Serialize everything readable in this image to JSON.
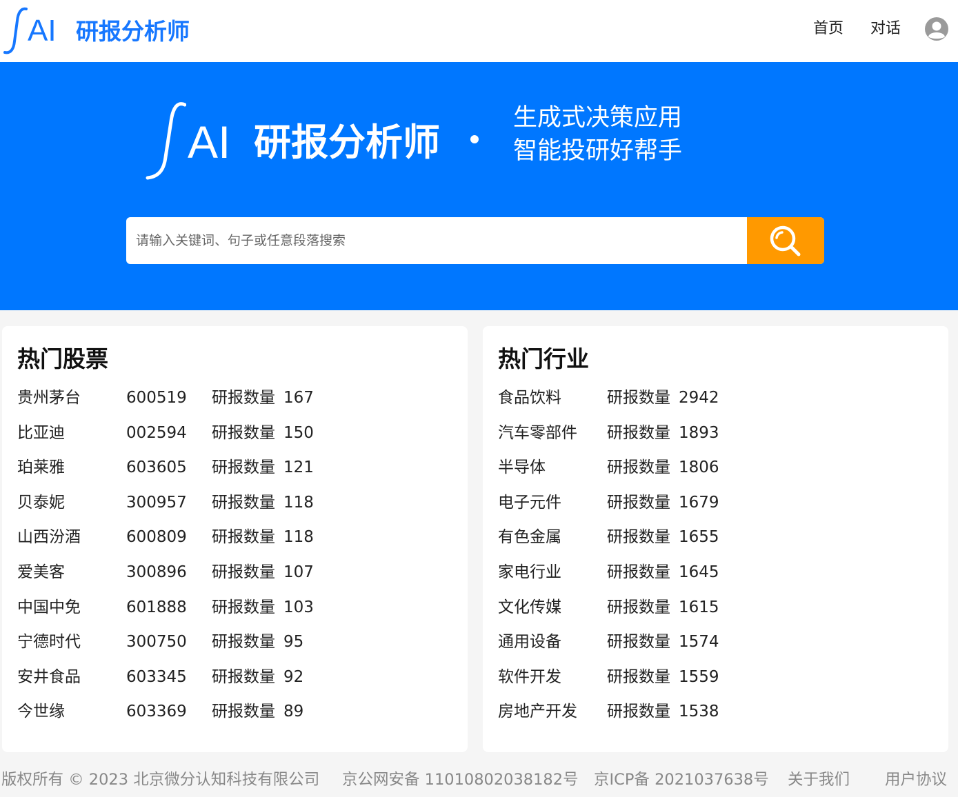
{
  "header": {
    "logo_ai": "AI",
    "app_name": "研报分析师",
    "nav": {
      "home": "首页",
      "chat": "对话"
    }
  },
  "hero": {
    "logo_ai": "AI",
    "app_name": "研报分析师",
    "tagline_line1": "生成式决策应用",
    "tagline_line2": "智能投研好帮手"
  },
  "search": {
    "placeholder": "请输入关键词、句子或任意段落搜索",
    "value": ""
  },
  "hot_stocks": {
    "title": "热门股票",
    "count_label": "研报数量",
    "items": [
      {
        "name": "贵州茅台",
        "code": "600519",
        "count": "167"
      },
      {
        "name": "比亚迪",
        "code": "002594",
        "count": "150"
      },
      {
        "name": "珀莱雅",
        "code": "603605",
        "count": "121"
      },
      {
        "name": "贝泰妮",
        "code": "300957",
        "count": "118"
      },
      {
        "name": "山西汾酒",
        "code": "600809",
        "count": "118"
      },
      {
        "name": "爱美客",
        "code": "300896",
        "count": "107"
      },
      {
        "name": "中国中免",
        "code": "601888",
        "count": "103"
      },
      {
        "name": "宁德时代",
        "code": "300750",
        "count": "95"
      },
      {
        "name": "安井食品",
        "code": "603345",
        "count": "92"
      },
      {
        "name": "今世缘",
        "code": "603369",
        "count": "89"
      }
    ]
  },
  "hot_industries": {
    "title": "热门行业",
    "count_label": "研报数量",
    "items": [
      {
        "name": "食品饮料",
        "count": "2942"
      },
      {
        "name": "汽车零部件",
        "count": "1893"
      },
      {
        "name": "半导体",
        "count": "1806"
      },
      {
        "name": "电子元件",
        "count": "1679"
      },
      {
        "name": "有色金属",
        "count": "1655"
      },
      {
        "name": "家电行业",
        "count": "1645"
      },
      {
        "name": "文化传媒",
        "count": "1615"
      },
      {
        "name": "通用设备",
        "count": "1574"
      },
      {
        "name": "软件开发",
        "count": "1559"
      },
      {
        "name": "房地产开发",
        "count": "1538"
      }
    ]
  },
  "footer": {
    "copyright": "版权所有 © 2023 北京微分认知科技有限公司",
    "beian": "京公网安备 11010802038182号",
    "icp": "京ICP备 2021037638号",
    "about": "关于我们",
    "terms": "用户协议"
  },
  "colors": {
    "brand_blue": "#0077ff",
    "logo_blue": "#1677ff",
    "search_orange": "#ff9900",
    "footer_gray": "#888888"
  },
  "icons": {
    "logo": "integral-sign-icon",
    "avatar": "user-avatar-icon",
    "search": "search-icon"
  }
}
